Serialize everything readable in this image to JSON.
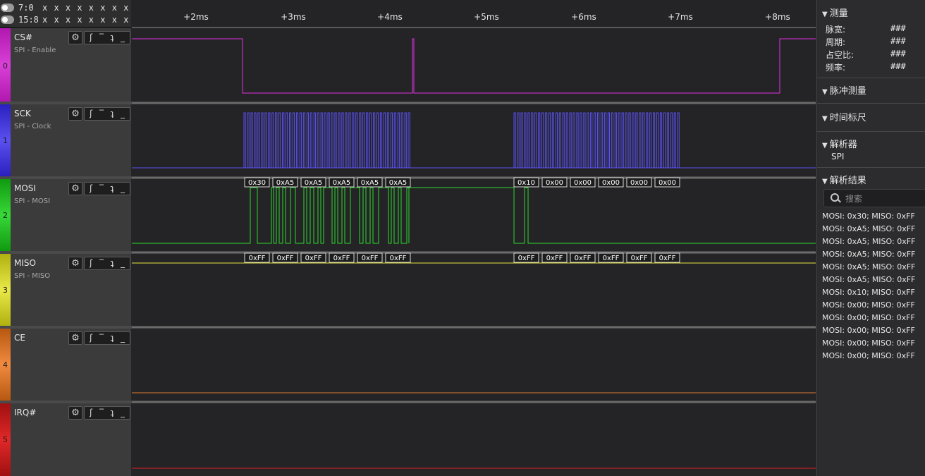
{
  "top_left": {
    "rows": [
      {
        "label": "7:0",
        "bits": "x x x x x x x x"
      },
      {
        "label": "15:8",
        "bits": "x x x x x x x x"
      }
    ]
  },
  "ruler": {
    "ticks": [
      "+2ms",
      "+3ms",
      "+4ms",
      "+5ms",
      "+6ms",
      "+7ms",
      "+8ms"
    ]
  },
  "channels": [
    {
      "index": "0",
      "name": "CS#",
      "desc": "SPI - Enable",
      "color": "#c81ec8",
      "wave_color": "#e030e0"
    },
    {
      "index": "1",
      "name": "SCK",
      "desc": "SPI - Clock",
      "color": "#3a2fd0",
      "wave_color": "#5a50f0"
    },
    {
      "index": "2",
      "name": "MOSI",
      "desc": "SPI - MOSI",
      "color": "#18b018",
      "wave_color": "#2ed82e"
    },
    {
      "index": "3",
      "name": "MISO",
      "desc": "SPI - MISO",
      "color": "#c8c81a",
      "wave_color": "#e8e840"
    },
    {
      "index": "4",
      "name": "CE",
      "desc": "",
      "color": "#d06a18",
      "wave_color": "#e07a30"
    },
    {
      "index": "5",
      "name": "IRQ#",
      "desc": "",
      "color": "#c01818",
      "wave_color": "#e02020"
    }
  ],
  "trigger_icons": [
    "rising-edge-icon",
    "high-level-icon",
    "falling-edge-icon",
    "low-level-icon"
  ],
  "decode": {
    "mosi_group1": [
      "0x30",
      "0xA5",
      "0xA5",
      "0xA5",
      "0xA5",
      "0xA5"
    ],
    "mosi_group2": [
      "0x10",
      "0x00",
      "0x00",
      "0x00",
      "0x00",
      "0x00"
    ],
    "miso_group1": [
      "0xFF",
      "0xFF",
      "0xFF",
      "0xFF",
      "0xFF",
      "0xFF"
    ],
    "miso_group2": [
      "0xFF",
      "0xFF",
      "0xFF",
      "0xFF",
      "0xFF",
      "0xFF"
    ]
  },
  "sidebar": {
    "measure": {
      "title": "测量",
      "rows": [
        {
          "label": "脉宽:",
          "value": "###"
        },
        {
          "label": "周期:",
          "value": "###"
        },
        {
          "label": "占空比:",
          "value": "###"
        },
        {
          "label": "频率:",
          "value": "###"
        }
      ]
    },
    "pulse_title": "脉冲测量",
    "timescale_title": "时间标尺",
    "analyzer": {
      "title": "解析器",
      "item": "SPI"
    },
    "results": {
      "title": "解析结果",
      "search_placeholder": "搜索",
      "items": [
        "MOSI: 0x30;  MISO: 0xFF",
        "MOSI: 0xA5;  MISO: 0xFF",
        "MOSI: 0xA5;  MISO: 0xFF",
        "MOSI: 0xA5;  MISO: 0xFF",
        "MOSI: 0xA5;  MISO: 0xFF",
        "MOSI: 0xA5;  MISO: 0xFF",
        "MOSI: 0x10;  MISO: 0xFF",
        "MOSI: 0x00;  MISO: 0xFF",
        "MOSI: 0x00;  MISO: 0xFF",
        "MOSI: 0x00;  MISO: 0xFF",
        "MOSI: 0x00;  MISO: 0xFF",
        "MOSI: 0x00;  MISO: 0xFF"
      ]
    }
  }
}
